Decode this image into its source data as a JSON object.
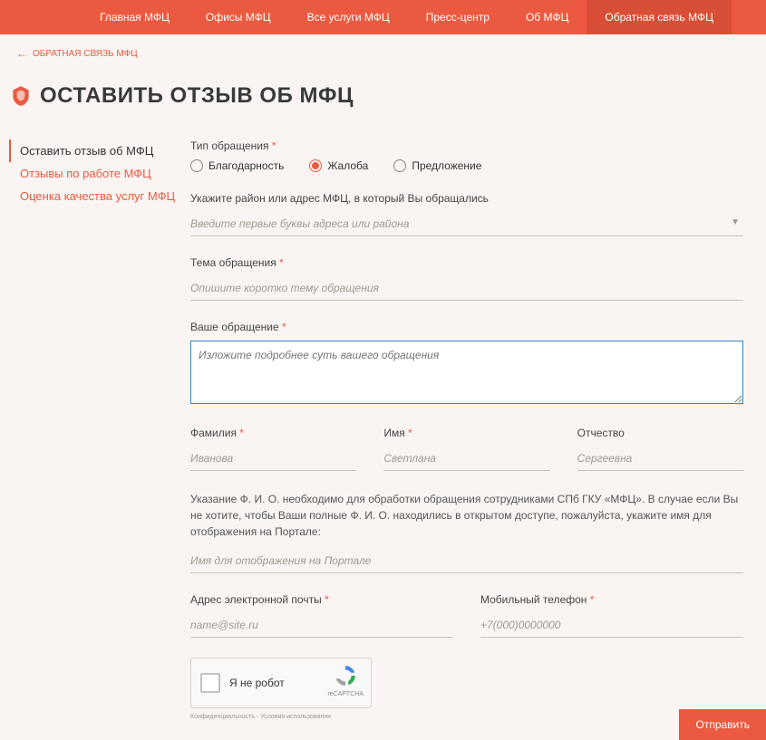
{
  "nav": {
    "items": [
      "Главная МФЦ",
      "Офисы МФЦ",
      "Все услуги МФЦ",
      "Пресс-центр",
      "Об МФЦ",
      "Обратная связь МФЦ"
    ],
    "active_index": 5
  },
  "breadcrumb": {
    "label": "ОБРАТНАЯ СВЯЗЬ МФЦ"
  },
  "page": {
    "title": "ОСТАВИТЬ ОТЗЫВ ОБ МФЦ"
  },
  "sidebar": {
    "items": [
      "Оставить отзыв об МФЦ",
      "Отзывы по работе МФЦ",
      "Оценка качества услуг МФЦ"
    ],
    "active_index": 0
  },
  "form": {
    "type_label": "Тип обращения",
    "type_options": [
      "Благодарность",
      "Жалоба",
      "Предложение"
    ],
    "type_selected_index": 1,
    "district_label": "Укажите район или адрес МФЦ, в который Вы обращались",
    "district_placeholder": "Введите первые буквы адреса или района",
    "topic_label": "Тема обращения",
    "topic_placeholder": "Опишите коротко тему обращения",
    "message_label": "Ваше обращение",
    "message_placeholder": "Изложите подробнее суть вашего обращения",
    "lastname_label": "Фамилия",
    "lastname_placeholder": "Иванова",
    "firstname_label": "Имя",
    "firstname_placeholder": "Светлана",
    "patronymic_label": "Отчество",
    "patronymic_placeholder": "Сергеевна",
    "name_hint": "Указание Ф. И. О. необходимо для обработки обращения сотрудниками СПб ГКУ «МФЦ». В случае если Вы не хотите, чтобы Ваши полные Ф. И. О. находились в открытом доступе, пожалуйста, укажите имя для отображения на Портале:",
    "display_name_placeholder": "Имя для отображения на Портале",
    "email_label": "Адрес электронной почты",
    "email_placeholder": "name@site.ru",
    "phone_label": "Мобильный телефон",
    "phone_placeholder": "+7(000)0000000",
    "captcha_label": "Я не робот",
    "captcha_brand": "reCAPTCHA",
    "captcha_footer": "Конфиденциальность - Условия использования",
    "submit_label": "Отправить"
  }
}
